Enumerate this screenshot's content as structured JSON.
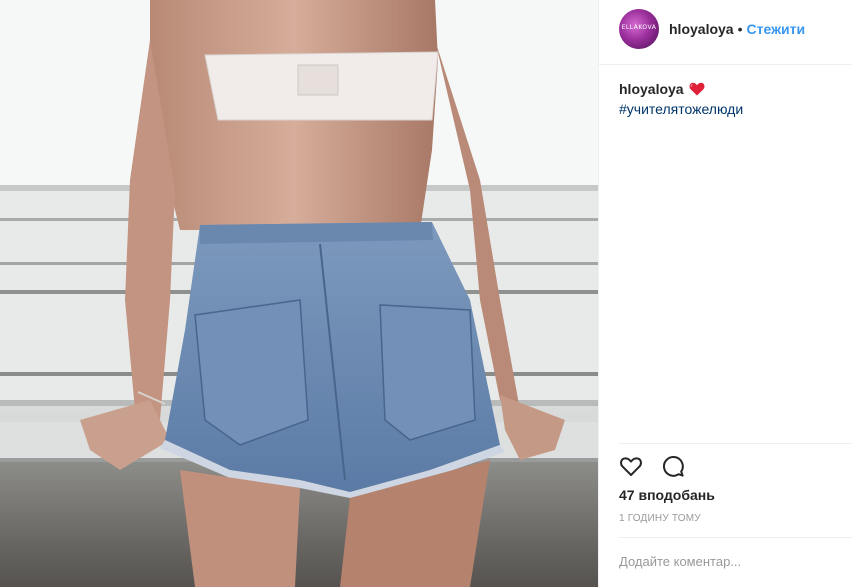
{
  "post": {
    "photo": {
      "alt": ""
    },
    "header": {
      "avatar_text": "ELLAKOVA",
      "username": "hloyaloya",
      "separator": "•",
      "follow_label": "Стежити"
    },
    "caption": {
      "username": "hloyaloya",
      "emoji": "heart-emoji",
      "hashtag": "#учителятожелюди"
    },
    "actions": {
      "like_icon": "heart-outline-icon",
      "comment_icon": "speech-bubble-icon"
    },
    "likes_text": "47 вподобань",
    "timestamp": "1 ГОДИНУ ТОМУ",
    "comment_placeholder": "Додайте коментар..."
  },
  "colors": {
    "link": "#3897f0",
    "hashtag": "#003569",
    "muted": "#999999",
    "divider": "#efefef",
    "heart_red": "#e0213a"
  }
}
